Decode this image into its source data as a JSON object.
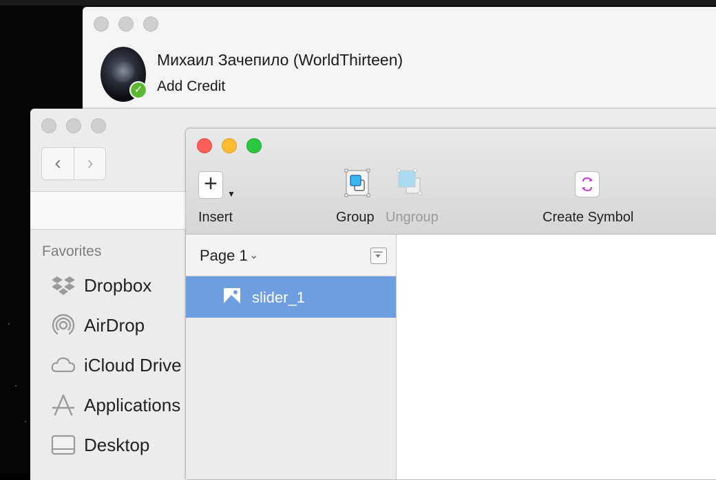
{
  "skype": {
    "contact_name": "Михаил Зачепило (WorldThirteen)",
    "action_link": "Add Credit",
    "status_color": "#5cb830"
  },
  "finder": {
    "sidebar_heading": "Favorites",
    "items": [
      {
        "label": "Dropbox",
        "icon": "dropbox-icon"
      },
      {
        "label": "AirDrop",
        "icon": "airdrop-icon"
      },
      {
        "label": "iCloud Drive",
        "icon": "icloud-icon"
      },
      {
        "label": "Applications",
        "icon": "applications-icon"
      },
      {
        "label": "Desktop",
        "icon": "desktop-icon"
      }
    ]
  },
  "sketch": {
    "toolbar": {
      "insert_label": "Insert",
      "group_label": "Group",
      "ungroup_label": "Ungroup",
      "create_symbol_label": "Create Symbol"
    },
    "page_selector": "Page 1",
    "layers": [
      {
        "name": "slider_1",
        "icon": "image-layer-icon",
        "selected": true
      }
    ],
    "selection_color": "#6d9ee0"
  }
}
